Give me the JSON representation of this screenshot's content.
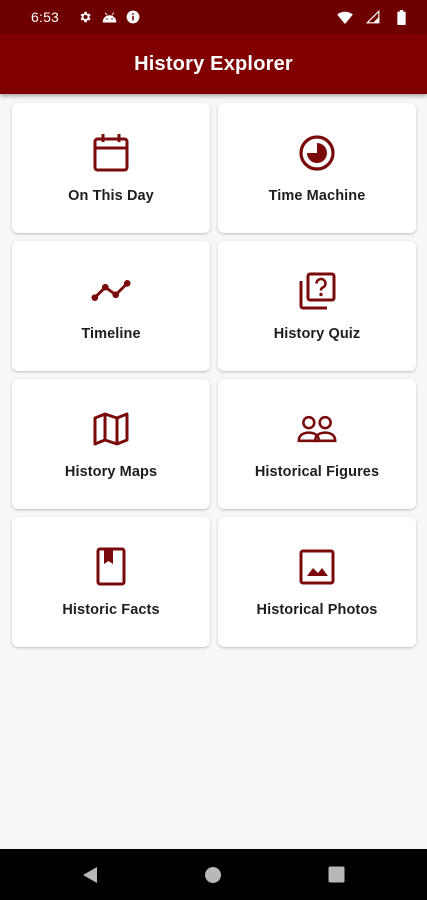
{
  "status_bar": {
    "time": "6:53",
    "left_icons": [
      "settings-icon",
      "android-icon",
      "info-icon"
    ],
    "right_icons": [
      "wifi-icon",
      "signal-icon",
      "battery-icon"
    ]
  },
  "app_bar": {
    "title": "History Explorer"
  },
  "colors": {
    "primary": "#800000",
    "status_bar": "#6f0000",
    "icon": "#7a0a0a",
    "background": "#f7f7f7",
    "card": "#ffffff"
  },
  "menu": [
    {
      "label": "On This Day",
      "icon": "calendar-icon"
    },
    {
      "label": "Time Machine",
      "icon": "clock-icon"
    },
    {
      "label": "Timeline",
      "icon": "timeline-icon"
    },
    {
      "label": "History Quiz",
      "icon": "quiz-icon"
    },
    {
      "label": "History Maps",
      "icon": "map-icon"
    },
    {
      "label": "Historical Figures",
      "icon": "people-icon"
    },
    {
      "label": "Historic Facts",
      "icon": "book-icon"
    },
    {
      "label": "Historical Photos",
      "icon": "photo-icon"
    }
  ],
  "nav_bar": {
    "buttons": [
      "back-icon",
      "home-icon",
      "recents-icon"
    ]
  }
}
